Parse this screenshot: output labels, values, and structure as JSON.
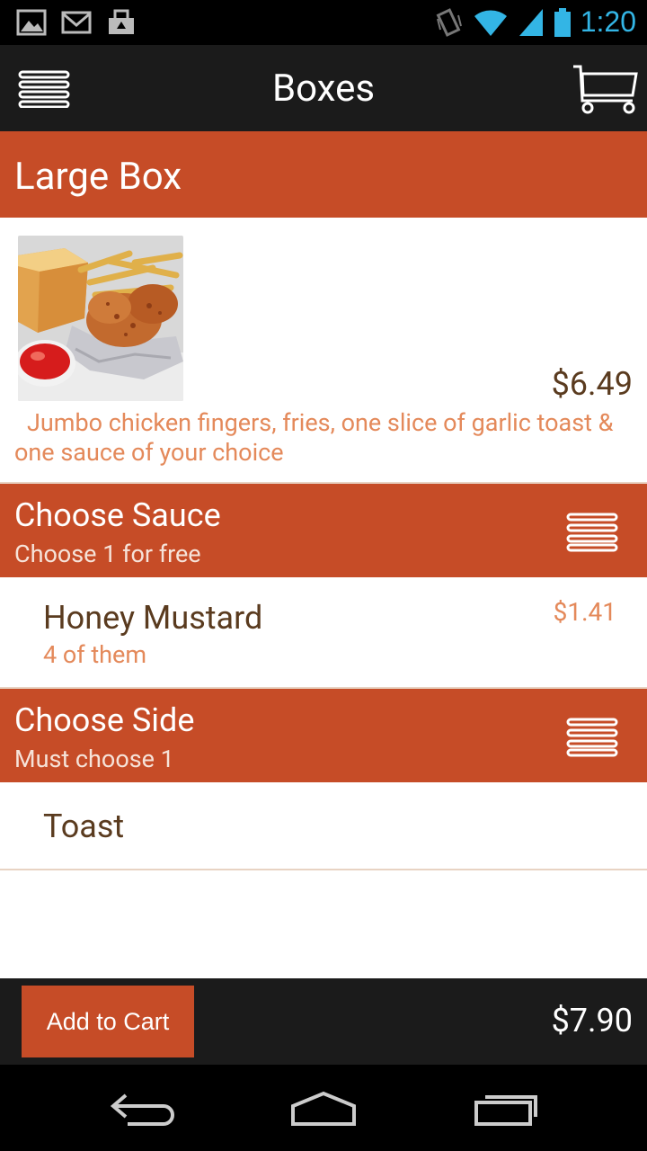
{
  "status_bar": {
    "time": "1:20",
    "icons": [
      "image-icon",
      "gmail-icon",
      "bag-icon",
      "vibrate-icon",
      "wifi-icon",
      "signal-icon",
      "battery-icon"
    ]
  },
  "action_bar": {
    "title": "Boxes",
    "menu_icon": "menu-icon",
    "cart_icon": "cart-icon"
  },
  "item": {
    "title": "Large Box",
    "price": "$6.49",
    "description": "Jumbo chicken fingers, fries, one slice of garlic toast & one sauce of your choice",
    "image": "chicken-fingers-photo"
  },
  "sections": [
    {
      "title": "Choose Sauce",
      "subtitle": "Choose 1 for free",
      "options": [
        {
          "name": "Honey Mustard",
          "subtitle": "4 of them",
          "price": "$1.41"
        }
      ]
    },
    {
      "title": "Choose Side",
      "subtitle": "Must choose 1",
      "options": [
        {
          "name": "Toast"
        }
      ]
    }
  ],
  "footer": {
    "add_to_cart_label": "Add to Cart",
    "total": "$7.90"
  },
  "colors": {
    "accent": "#c64c27",
    "dark_bar": "#1b1b1b",
    "text_brown": "#5a3b1f",
    "text_orange": "#e4895a",
    "status_blue": "#33b5e5"
  }
}
